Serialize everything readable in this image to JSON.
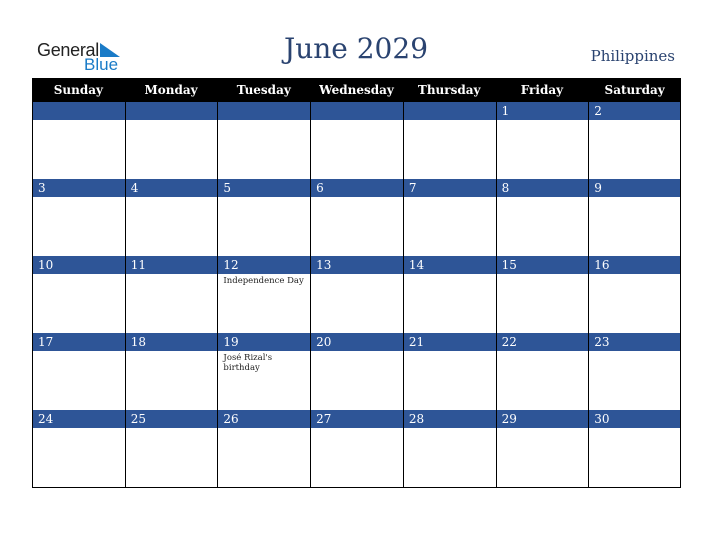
{
  "logo": {
    "line1": "General",
    "line2": "Blue"
  },
  "title": "June 2029",
  "country": "Philippines",
  "days": [
    "Sunday",
    "Monday",
    "Tuesday",
    "Wednesday",
    "Thursday",
    "Friday",
    "Saturday"
  ],
  "weeks": [
    [
      {
        "d": ""
      },
      {
        "d": ""
      },
      {
        "d": ""
      },
      {
        "d": ""
      },
      {
        "d": ""
      },
      {
        "d": "1"
      },
      {
        "d": "2"
      }
    ],
    [
      {
        "d": "3"
      },
      {
        "d": "4"
      },
      {
        "d": "5"
      },
      {
        "d": "6"
      },
      {
        "d": "7"
      },
      {
        "d": "8"
      },
      {
        "d": "9"
      }
    ],
    [
      {
        "d": "10"
      },
      {
        "d": "11"
      },
      {
        "d": "12",
        "e": "Independence Day"
      },
      {
        "d": "13"
      },
      {
        "d": "14"
      },
      {
        "d": "15"
      },
      {
        "d": "16"
      }
    ],
    [
      {
        "d": "17"
      },
      {
        "d": "18"
      },
      {
        "d": "19",
        "e": "José Rizal's birthday"
      },
      {
        "d": "20"
      },
      {
        "d": "21"
      },
      {
        "d": "22"
      },
      {
        "d": "23"
      }
    ],
    [
      {
        "d": "24"
      },
      {
        "d": "25"
      },
      {
        "d": "26"
      },
      {
        "d": "27"
      },
      {
        "d": "28"
      },
      {
        "d": "29"
      },
      {
        "d": "30"
      }
    ]
  ]
}
